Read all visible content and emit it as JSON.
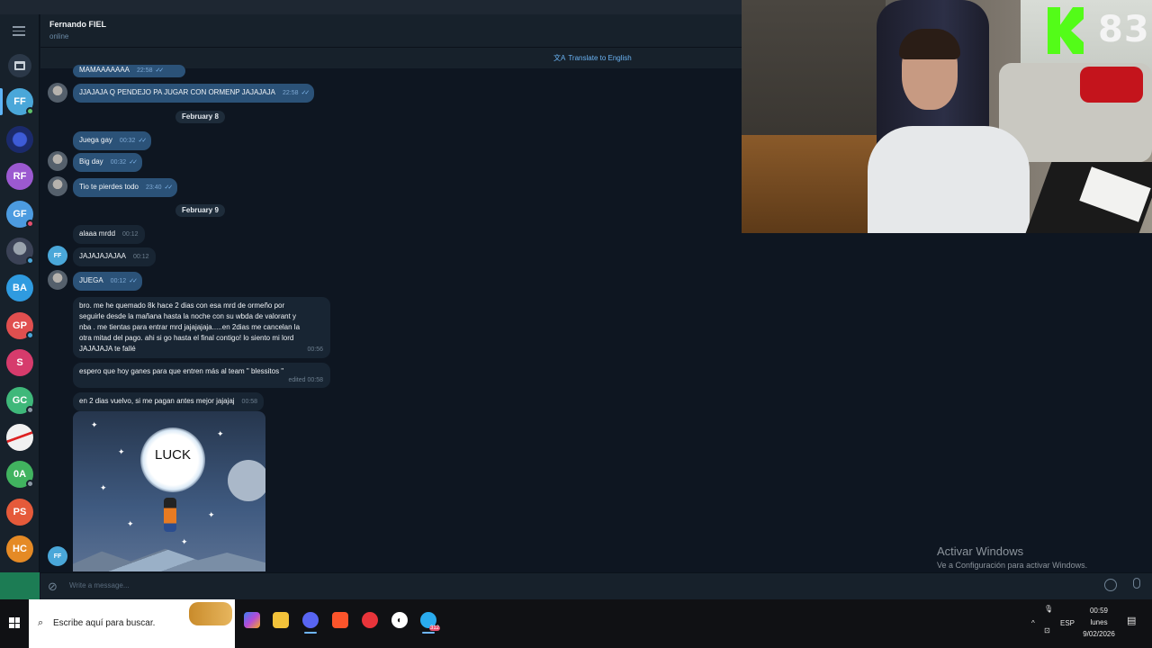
{
  "chat_header": {
    "name": "Fernando FIEL",
    "status": "online",
    "translate": "Translate to English"
  },
  "sidebar": {
    "avatars": [
      {
        "initials": "FF",
        "color": "#4aa7d9",
        "dot": "#5ec26a"
      },
      {
        "initials": "",
        "color": "#1b2a6b",
        "dot": ""
      },
      {
        "initials": "RF",
        "color": "#9b59d0",
        "dot": ""
      },
      {
        "initials": "GF",
        "color": "#4c9be0",
        "dot": "#e54f6d"
      },
      {
        "initials": "",
        "color": "#3b4256",
        "dot": "#4aa7d9"
      },
      {
        "initials": "BA",
        "color": "#2f9be0",
        "dot": ""
      },
      {
        "initials": "GP",
        "color": "#e04f4f",
        "dot": "#4aa7d9"
      },
      {
        "initials": "S",
        "color": "#d63b6c",
        "dot": ""
      },
      {
        "initials": "GC",
        "color": "#3fb87a",
        "dot": "#8c98a5"
      },
      {
        "initials": "",
        "color": "#f1f1f1",
        "dot": ""
      },
      {
        "initials": "0A",
        "color": "#41b35f",
        "dot": "#8c98a5"
      },
      {
        "initials": "PS",
        "color": "#e55a3a",
        "dot": ""
      },
      {
        "initials": "HC",
        "color": "#e58a25",
        "dot": ""
      }
    ]
  },
  "messages": [
    {
      "text": "MAMAAAAAAA",
      "time": "22:58",
      "dir": "out"
    },
    {
      "text": "JJAJAJA Q PENDEJO PA JUGAR CON ORMENP JAJAJAJA",
      "time": "22:58",
      "dir": "out"
    },
    {
      "date": "February 8"
    },
    {
      "text": "Juega gay",
      "time": "00:32",
      "dir": "out"
    },
    {
      "text": "Big day",
      "time": "00:32",
      "dir": "out"
    },
    {
      "text": "Tio te pierdes todo",
      "time": "23:40",
      "dir": "out"
    },
    {
      "date": "February 9"
    },
    {
      "text": "alaaa mrdd",
      "time": "00:12",
      "dir": "in"
    },
    {
      "text": "JAJAJAJAJAA",
      "time": "00:12",
      "dir": "in"
    },
    {
      "text": "JUEGA",
      "time": "00:12",
      "dir": "out"
    },
    {
      "text_lines": [
        "bro. me he quemado 8k hace 2 dias con esa mrd de ormeño  por",
        "seguirle desde la mañana hasta la noche con su wbda de valorant y",
        "nba . me tientas para entrar mrd jajajajaja.....en 2dias me cancelan la",
        "otra mitad del pago. ahi si go hasta el final contigo! lo siento mi lord",
        "JAJAJAJA te fallé"
      ],
      "time": "00:56",
      "dir": "in"
    },
    {
      "text": "espero que hoy ganes para que entren más al team \" blessitos \"",
      "time": "edited 00:58",
      "dir": "in"
    },
    {
      "text": "en 2 dias vuelvo, si me pagan antes mejor jajajaj",
      "time": "00:58",
      "dir": "in"
    },
    {
      "sticker_text": "LUCK"
    }
  ],
  "composer": {
    "placeholder": "Write a message..."
  },
  "stream_badge": {
    "value": "83"
  },
  "watermark": {
    "title": "Activar Windows",
    "subtitle": "Ve a Configuración para activar Windows."
  },
  "taskbar": {
    "search_placeholder": "Escribe aquí para buscar.",
    "lang": "ESP",
    "time": "00:59",
    "day": "lunes",
    "date": "9/02/2026",
    "telegram_badge": "312"
  }
}
